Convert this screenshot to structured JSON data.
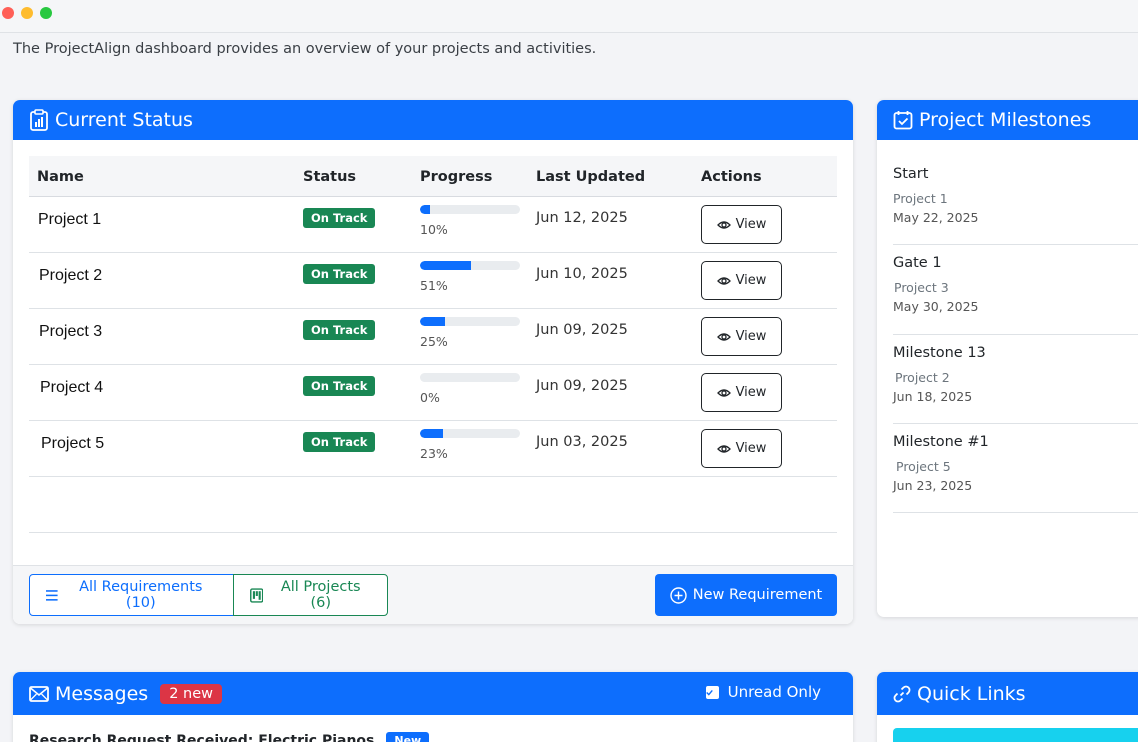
{
  "window": {
    "controls": [
      "close",
      "minimize",
      "maximize"
    ]
  },
  "intro_text": "The ProjectAlign dashboard provides an overview of your projects and activities.",
  "status": {
    "title": "Current Status",
    "columns": {
      "name": "Name",
      "status": "Status",
      "progress": "Progress",
      "updated": "Last Updated",
      "actions": "Actions"
    },
    "rows": [
      {
        "name": "Project 1",
        "status": "On Track",
        "progress": 0.1,
        "progress_label": "10%",
        "updated": "Jun 12, 2025",
        "action": "View"
      },
      {
        "name": "Project 2",
        "status": "On Track",
        "progress": 0.51,
        "progress_label": "51%",
        "updated": "Jun 10, 2025",
        "action": "View"
      },
      {
        "name": "Project 3",
        "status": "On Track",
        "progress": 0.25,
        "progress_label": "25%",
        "updated": "Jun 09, 2025",
        "action": "View"
      },
      {
        "name": "Project 4",
        "status": "On Track",
        "progress": 0.0,
        "progress_label": "0%",
        "updated": "Jun 09, 2025",
        "action": "View"
      },
      {
        "name": "Project 5",
        "status": "On Track",
        "progress": 0.23,
        "progress_label": "23%",
        "updated": "Jun 03, 2025",
        "action": "View"
      }
    ],
    "footer": {
      "all_requirements": "All Requirements (10)",
      "all_projects": "All Projects (6)",
      "new_requirement": "New Requirement"
    }
  },
  "milestones": {
    "title": "Project Milestones",
    "items": [
      {
        "title": "Start",
        "project": "Project 1",
        "date": "May 22, 2025"
      },
      {
        "title": "Gate 1",
        "project": "Project 3",
        "date": "May 30, 2025"
      },
      {
        "title": "Milestone 13",
        "project": "Project 2",
        "date": "Jun 18, 2025"
      },
      {
        "title": "Milestone #1",
        "project": "Project 5",
        "date": "Jun 23, 2025"
      }
    ]
  },
  "messages": {
    "title": "Messages",
    "new_count": "2 new",
    "unread_only": "Unread Only",
    "first_message": "Research Request Received: Electric Pianos",
    "first_message_badge": "New"
  },
  "quick_links": {
    "title": "Quick Links"
  },
  "colors": {
    "primary": "#0d6efd",
    "success": "#198754",
    "danger": "#dc3545",
    "info": "#17d1ee"
  }
}
